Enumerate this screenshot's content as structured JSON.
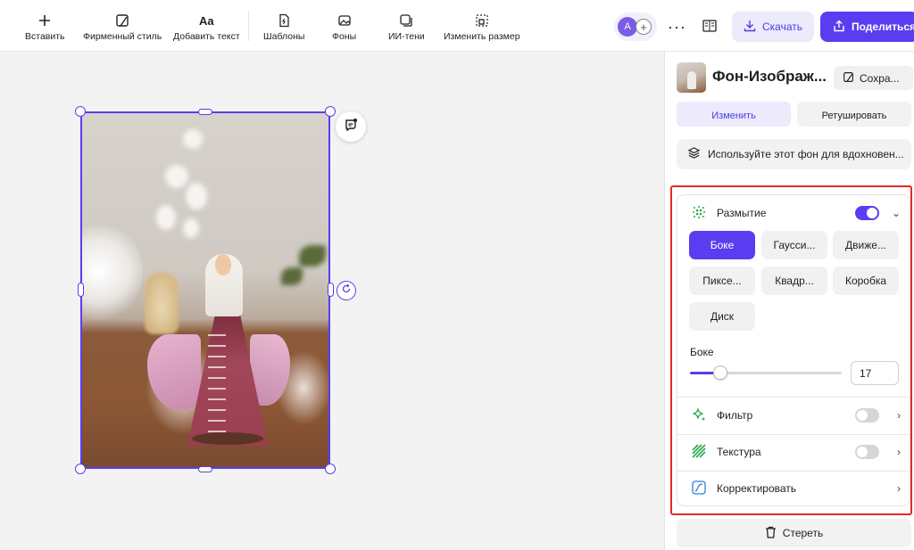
{
  "toolbar": {
    "insert": "Вставить",
    "brand": "Фирменный стиль",
    "add_text": "Добавить текст",
    "add_text_icon_text": "Aa",
    "templates": "Шаблоны",
    "backgrounds": "Фоны",
    "ai_shadows": "ИИ-тени",
    "resize": "Изменить размер",
    "avatar_initial": "A",
    "more": "···",
    "download": "Скачать",
    "share": "Поделиться"
  },
  "panel": {
    "title": "Фон-Изображ...",
    "save": "Сохра...",
    "tab_edit": "Изменить",
    "tab_retouch": "Ретушировать",
    "inspire": "Используйте этот фон для вдохновен...",
    "blur": {
      "label": "Размытие",
      "enabled": true,
      "options": [
        "Боке",
        "Гаусси...",
        "Движе...",
        "Пиксе...",
        "Квадр...",
        "Коробка",
        "Диск"
      ],
      "selected": "Боке"
    },
    "slider": {
      "label": "Боке",
      "value": "17",
      "fraction": 0.2
    },
    "filter": {
      "label": "Фильтр",
      "enabled": false
    },
    "texture": {
      "label": "Текстура",
      "enabled": false
    },
    "adjust": {
      "label": "Корректировать"
    },
    "erase": "Стереть"
  },
  "colors": {
    "accent": "#5a3df0",
    "highlight_box": "#e32a2a"
  }
}
